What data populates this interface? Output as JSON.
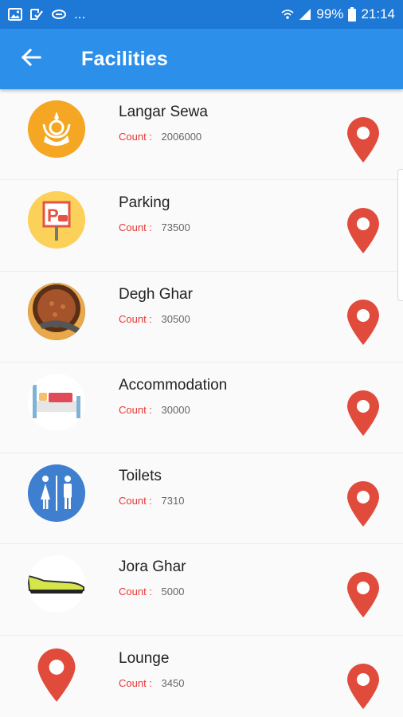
{
  "status_bar": {
    "dots": "...",
    "battery": "99%",
    "time": "21:14",
    "icons": [
      "image-icon",
      "check-notification-icon",
      "link-icon",
      "wifi-icon",
      "signal-icon",
      "battery-icon"
    ]
  },
  "app_bar": {
    "title": "Facilities",
    "back_icon": "arrow-back-icon",
    "color": "#2c8fea"
  },
  "colors": {
    "status_bar": "#1e78d6",
    "count_label": "#e53935",
    "pin": "#e04b3c"
  },
  "facilities": [
    {
      "name": "Langar Sewa",
      "count_label": "Count :",
      "count": "2006000",
      "icon": "khanda-icon"
    },
    {
      "name": "Parking",
      "count_label": "Count :",
      "count": "73500",
      "icon": "parking-icon"
    },
    {
      "name": "Degh Ghar",
      "count_label": "Count :",
      "count": "30500",
      "icon": "degh-icon"
    },
    {
      "name": "Accommodation",
      "count_label": "Count :",
      "count": "30000",
      "icon": "bed-icon"
    },
    {
      "name": "Toilets",
      "count_label": "Count :",
      "count": "7310",
      "icon": "restroom-icon"
    },
    {
      "name": "Jora Ghar",
      "count_label": "Count :",
      "count": "5000",
      "icon": "shoe-icon"
    },
    {
      "name": "Lounge",
      "count_label": "Count :",
      "count": "3450",
      "icon": "location-pin-icon"
    }
  ]
}
